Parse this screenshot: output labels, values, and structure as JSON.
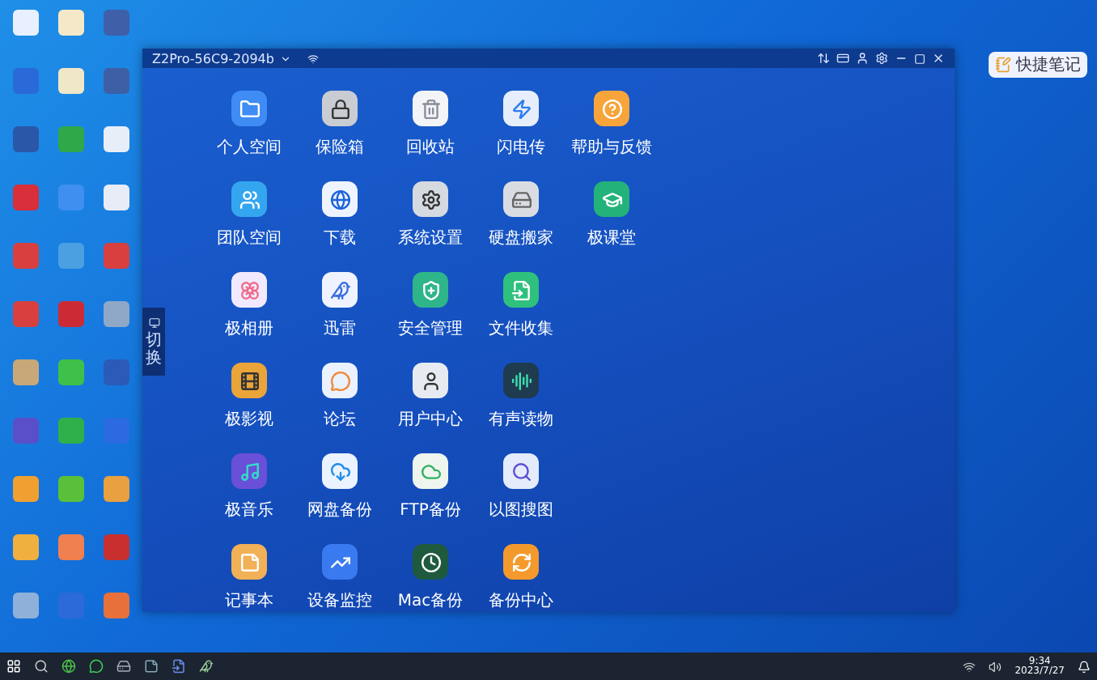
{
  "window": {
    "title": "Z2Pro-56C9-2094b"
  },
  "side_tab": {
    "label": "切换"
  },
  "apps": [
    [
      {
        "label": "个人空间",
        "kind": "folder"
      },
      {
        "label": "保险箱",
        "kind": "safe"
      },
      {
        "label": "回收站",
        "kind": "trash"
      },
      {
        "label": "闪电传",
        "kind": "transfer"
      },
      {
        "label": "帮助与反馈",
        "kind": "help"
      }
    ],
    [
      {
        "label": "团队空间",
        "kind": "team"
      },
      {
        "label": "下载",
        "kind": "download"
      },
      {
        "label": "系统设置",
        "kind": "settings"
      },
      {
        "label": "硬盘搬家",
        "kind": "disk"
      },
      {
        "label": "极课堂",
        "kind": "class"
      }
    ],
    [
      {
        "label": "极相册",
        "kind": "photos"
      },
      {
        "label": "迅雷",
        "kind": "bird"
      },
      {
        "label": "安全管理",
        "kind": "security"
      },
      {
        "label": "文件收集",
        "kind": "collect"
      }
    ],
    [
      {
        "label": "极影视",
        "kind": "video"
      },
      {
        "label": "论坛",
        "kind": "forum"
      },
      {
        "label": "用户中心",
        "kind": "user"
      },
      {
        "label": "有声读物",
        "kind": "audio"
      }
    ],
    [
      {
        "label": "极音乐",
        "kind": "music"
      },
      {
        "label": "网盘备份",
        "kind": "cloud"
      },
      {
        "label": "FTP备份",
        "kind": "ftp"
      },
      {
        "label": "以图搜图",
        "kind": "search"
      }
    ],
    [
      {
        "label": "记事本",
        "kind": "notes"
      },
      {
        "label": "设备监控",
        "kind": "monitor"
      },
      {
        "label": "Mac备份",
        "kind": "mac"
      },
      {
        "label": "备份中心",
        "kind": "backup"
      }
    ]
  ],
  "quick_note": {
    "label": "快捷笔记"
  },
  "taskbar": {
    "time": "9:34",
    "date": "2023/7/27"
  }
}
